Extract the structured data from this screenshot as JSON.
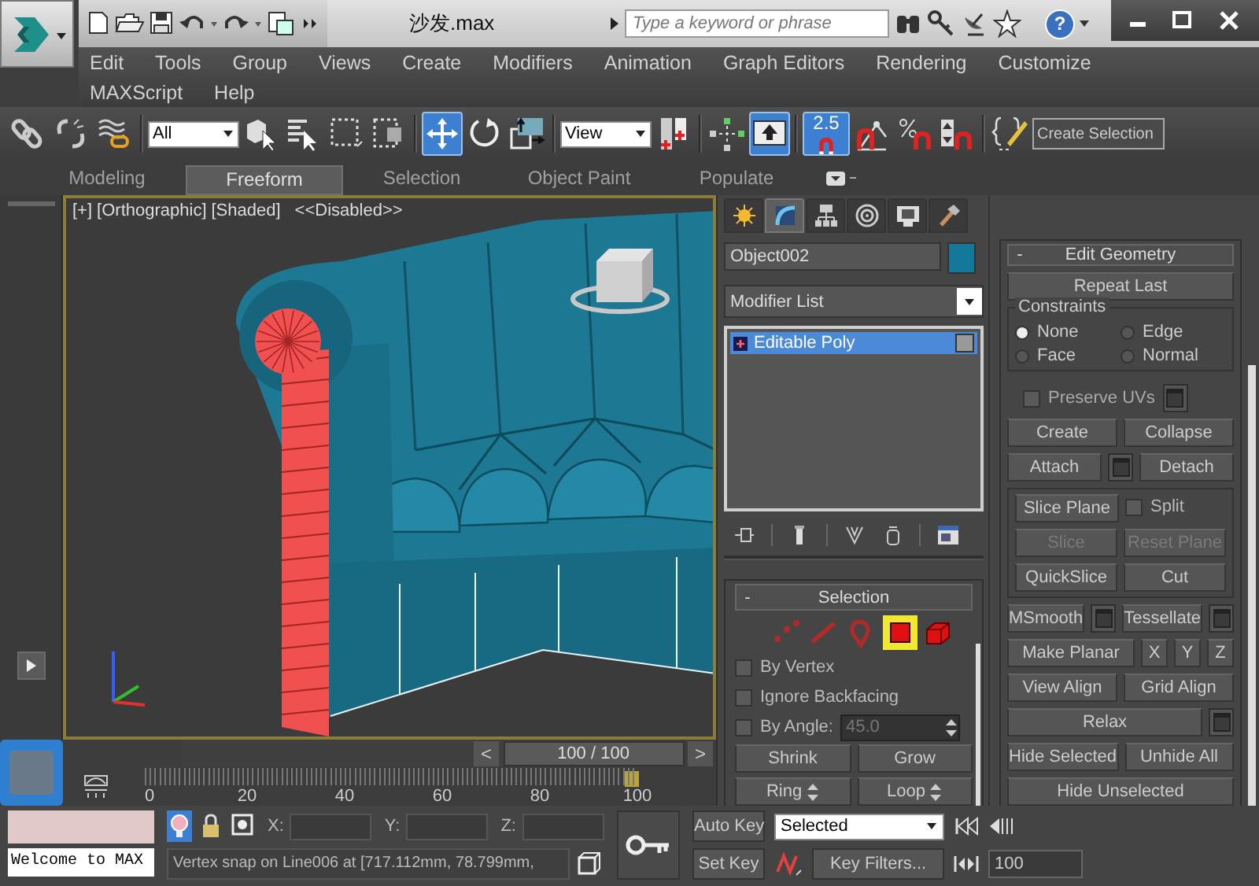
{
  "title_bar": {
    "title": "沙发.max",
    "search": {
      "placeholder": "Type a keyword or phrase"
    },
    "help": "?"
  },
  "menu_rows": [
    [
      "Edit",
      "Tools",
      "Group",
      "Views",
      "Create",
      "Modifiers",
      "Animation",
      "Graph Editors",
      "Rendering",
      "Customize"
    ],
    [
      "MAXScript",
      "Help"
    ]
  ],
  "toolbar": [
    [
      {
        "kind": "icon",
        "on": false
      },
      {
        "kind": "icon",
        "on": false
      },
      {
        "kind": "icon",
        "on": false
      }
    ],
    [
      {
        "kind": "dropdown",
        "value": "All"
      },
      {
        "kind": "icon",
        "on": false
      },
      {
        "kind": "icon",
        "on": false
      },
      {
        "kind": "icon",
        "on": false
      },
      {
        "kind": "icon",
        "on": false
      }
    ],
    [
      {
        "kind": "icon",
        "on": true
      },
      {
        "kind": "icon",
        "on": false
      },
      {
        "kind": "icon",
        "on": false
      }
    ],
    [
      {
        "kind": "dropdown",
        "value": "View"
      },
      {
        "kind": "icon",
        "on": false
      }
    ],
    [
      {
        "kind": "icon",
        "on": false
      },
      {
        "kind": "icon",
        "on": true
      }
    ],
    [
      {
        "kind": "snap",
        "label": "2.5",
        "on": true
      },
      {
        "kind": "icon",
        "on": false
      },
      {
        "kind": "icon",
        "on": false
      },
      {
        "kind": "icon",
        "on": false
      }
    ],
    [
      {
        "kind": "icon",
        "on": false
      },
      {
        "kind": "field",
        "value": "Create Selection"
      }
    ]
  ],
  "ribbon_tabs": [
    {
      "label": "Modeling",
      "selected": false
    },
    {
      "label": "Freeform",
      "selected": true
    },
    {
      "label": "Selection",
      "selected": false
    },
    {
      "label": "Object Paint",
      "selected": false
    },
    {
      "label": "Populate",
      "selected": false
    }
  ],
  "viewport": {
    "labels": [
      "[+]",
      "[Orthographic]",
      "[Shaded]",
      "<<Disabled>>"
    ]
  },
  "time_slider": {
    "prev": "<",
    "reading": "100 / 100",
    "next": ">",
    "level": 1
  },
  "timeline": {
    "ticks": [
      "0",
      "20",
      "40",
      "60",
      "80",
      "100"
    ]
  },
  "command_panel": {
    "tabs": [
      {
        "selected": false
      },
      {
        "selected": true
      },
      {
        "selected": false
      },
      {
        "selected": false
      },
      {
        "selected": false
      },
      {
        "selected": false
      }
    ],
    "object_name": "Object002",
    "modifier_list": "Modifier List",
    "stack": [
      {
        "label": "Editable Poly",
        "selected": true
      }
    ],
    "selection": {
      "collapse": "-",
      "title": "Selection",
      "levels": [
        {
          "selected": false
        },
        {
          "selected": false
        },
        {
          "selected": false
        },
        {
          "selected": true
        },
        {
          "selected": false
        }
      ],
      "options": [
        {
          "label": "By Vertex",
          "checked": false
        },
        {
          "label": "Ignore Backfacing",
          "checked": false
        },
        {
          "label": "By Angle:",
          "checked": false,
          "value": "45.0",
          "value_disabled": true
        }
      ],
      "buttons": [
        {
          "label": "Shrink",
          "kind": "plain"
        },
        {
          "label": "Grow",
          "kind": "plain"
        },
        {
          "label": "Ring",
          "kind": "spinner"
        },
        {
          "label": "Loop",
          "kind": "spinner"
        }
      ]
    },
    "edit_geometry": {
      "collapse": "-",
      "title": "Edit Geometry",
      "repeat": "Repeat Last",
      "constraints": {
        "title": "Constraints",
        "options": [
          {
            "label": "None",
            "selected": true
          },
          {
            "label": "Edge",
            "selected": false
          },
          {
            "label": "Face",
            "selected": false
          },
          {
            "label": "Normal",
            "selected": false
          }
        ]
      },
      "preserve_uvs": {
        "label": "Preserve UVs",
        "checked": false
      },
      "rows_top": [
        [
          {
            "kind": "button",
            "label": "Create"
          },
          {
            "kind": "button",
            "label": "Collapse"
          }
        ],
        [
          {
            "kind": "button",
            "label": "Attach"
          },
          {
            "kind": "settings"
          },
          {
            "kind": "button",
            "label": "Detach"
          }
        ]
      ],
      "slice_group": [
        [
          {
            "kind": "button",
            "label": "Slice Plane",
            "disabled": false
          },
          {
            "kind": "check",
            "label": "Split",
            "checked": false
          }
        ],
        [
          {
            "kind": "button",
            "label": "Slice",
            "disabled": true
          },
          {
            "kind": "button",
            "label": "Reset Plane",
            "disabled": true
          }
        ],
        [
          {
            "kind": "button",
            "label": "QuickSlice",
            "disabled": false
          },
          {
            "kind": "button",
            "label": "Cut",
            "disabled": false
          }
        ]
      ],
      "rows_bottom": [
        [
          {
            "kind": "button",
            "label": "MSmooth"
          },
          {
            "kind": "settings"
          },
          {
            "kind": "button",
            "label": "Tessellate"
          },
          {
            "kind": "settings"
          }
        ],
        [
          {
            "kind": "button",
            "label": "Make Planar"
          },
          {
            "kind": "small",
            "label": "X"
          },
          {
            "kind": "small",
            "label": "Y"
          },
          {
            "kind": "small",
            "label": "Z"
          }
        ],
        [
          {
            "kind": "button",
            "label": "View Align"
          },
          {
            "kind": "button",
            "label": "Grid Align"
          }
        ],
        [
          {
            "kind": "button",
            "label": "Relax"
          },
          {
            "kind": "settings"
          }
        ],
        [
          {
            "kind": "button",
            "label": "Hide Selected"
          },
          {
            "kind": "button",
            "label": "Unhide All"
          }
        ],
        [
          {
            "kind": "button",
            "label": "Hide Unselected"
          }
        ]
      ]
    }
  },
  "status_bar": {
    "listener": "Welcome to MAX",
    "tools": [
      {
        "on": true
      },
      {
        "on": false
      },
      {
        "on": false
      }
    ],
    "coords": [
      "X:",
      "Y:",
      "Z:"
    ],
    "prompt": "Vertex snap on Line006 at [717.112mm, 78.799mm,",
    "auto_key": "Auto Key",
    "key_mode": "Selected",
    "set_key": "Set Key",
    "key_filters": "Key Filters...",
    "frame": "100"
  }
}
